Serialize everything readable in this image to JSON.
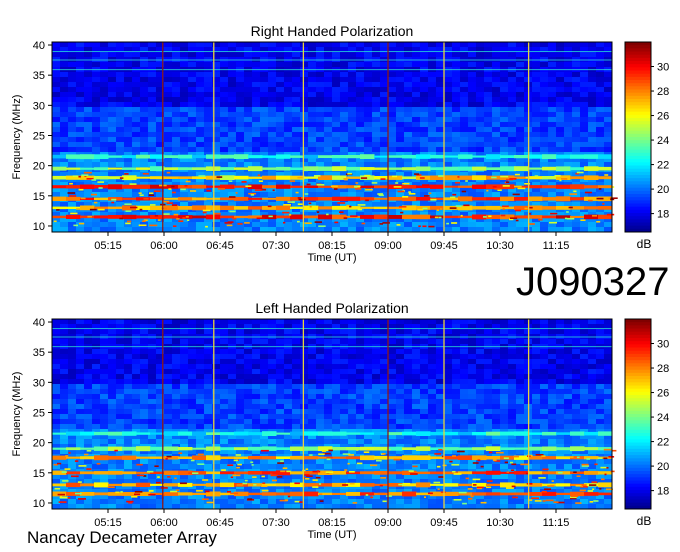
{
  "figure": {
    "id_label": "J090327",
    "footer": "Nancay Decameter Array"
  },
  "chart_data": [
    {
      "type": "heatmap",
      "title": "Right Handed Polarization",
      "xlabel": "Time (UT)",
      "ylabel": "Frequency (MHz)",
      "x_ticks": [
        "05:15",
        "06:00",
        "06:45",
        "07:30",
        "08:15",
        "09:00",
        "09:45",
        "10:30",
        "11:15"
      ],
      "x_range_minutes": [
        270,
        720
      ],
      "y_ticks": [
        10,
        15,
        20,
        25,
        30,
        35,
        40
      ],
      "ylim": [
        9,
        40.5
      ],
      "colorbar": {
        "label": "dB",
        "ticks": [
          18,
          20,
          22,
          24,
          26,
          28,
          30
        ],
        "range": [
          16.5,
          32
        ],
        "colormap": "jet"
      },
      "markers_time": [
        "05:59",
        "06:40",
        "07:52",
        "09:00",
        "09:45",
        "10:53"
      ],
      "emission_bands": [
        {
          "freq": 11.5,
          "level": 31,
          "description": "strong low-frequency band"
        },
        {
          "freq": 13.0,
          "level": 29
        },
        {
          "freq": 14.5,
          "level": 30
        },
        {
          "freq": 16.5,
          "level": 31
        },
        {
          "freq": 18.0,
          "level": 28
        },
        {
          "freq": 19.5,
          "level": 26
        },
        {
          "freq": 21.5,
          "level": 24
        }
      ]
    },
    {
      "type": "heatmap",
      "title": "Left Handed Polarization",
      "xlabel": "Time (UT)",
      "ylabel": "Frequency (MHz)",
      "x_ticks": [
        "05:15",
        "06:00",
        "06:45",
        "07:30",
        "08:15",
        "09:00",
        "09:45",
        "10:30",
        "11:15"
      ],
      "x_range_minutes": [
        270,
        720
      ],
      "y_ticks": [
        10,
        15,
        20,
        25,
        30,
        35,
        40
      ],
      "ylim": [
        9,
        40.5
      ],
      "colorbar": {
        "label": "dB",
        "ticks": [
          18,
          20,
          22,
          24,
          26,
          28,
          30
        ],
        "range": [
          16.5,
          32
        ],
        "colormap": "jet"
      },
      "markers_time": [
        "05:59",
        "06:40",
        "07:52",
        "09:00",
        "09:45",
        "10:53"
      ],
      "emission_bands": [
        {
          "freq": 11.5,
          "level": 30
        },
        {
          "freq": 13.0,
          "level": 29
        },
        {
          "freq": 15.0,
          "level": 30
        },
        {
          "freq": 17.5,
          "level": 29
        },
        {
          "freq": 19.0,
          "level": 26
        },
        {
          "freq": 21.5,
          "level": 24
        }
      ]
    }
  ]
}
